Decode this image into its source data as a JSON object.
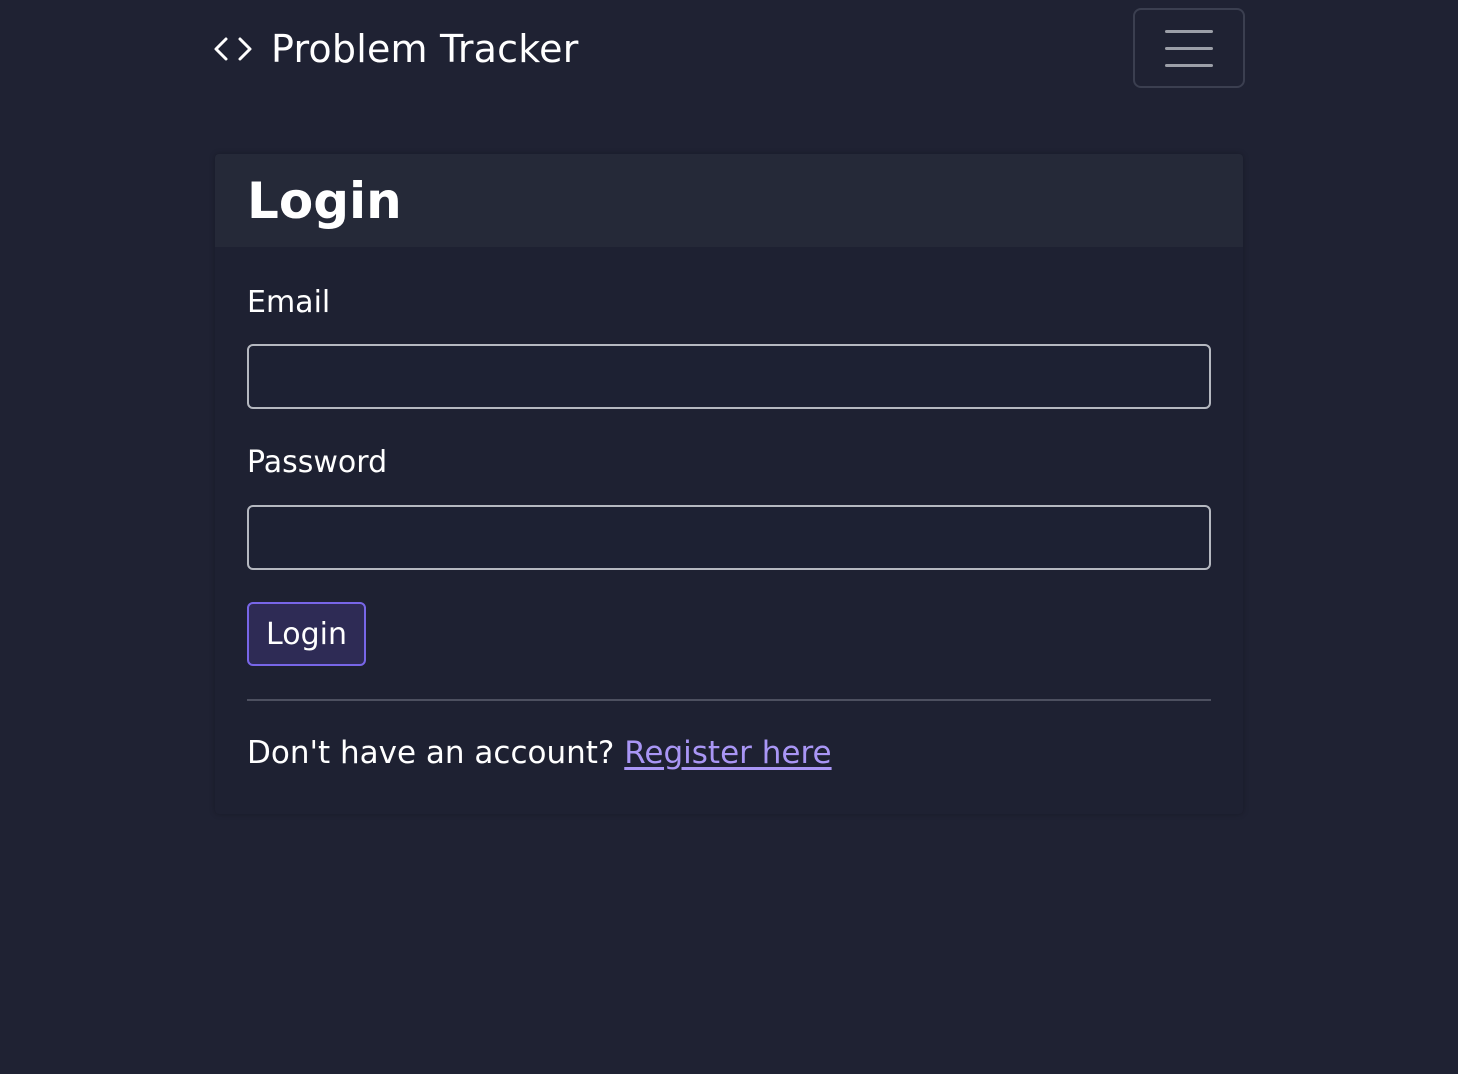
{
  "navbar": {
    "brand_icon": "code-brackets-icon",
    "brand_text": "Problem Tracker",
    "toggler_icon": "hamburger-menu-icon"
  },
  "login_card": {
    "title": "Login",
    "email": {
      "label": "Email",
      "value": "",
      "placeholder": ""
    },
    "password": {
      "label": "Password",
      "value": "",
      "placeholder": ""
    },
    "submit_label": "Login",
    "footer_prefix": "Don't have an account? ",
    "register_link_label": "Register here"
  },
  "colors": {
    "background": "#1f2233",
    "card_header": "#252938",
    "accent": "#7866e8",
    "link": "#a996f5"
  }
}
